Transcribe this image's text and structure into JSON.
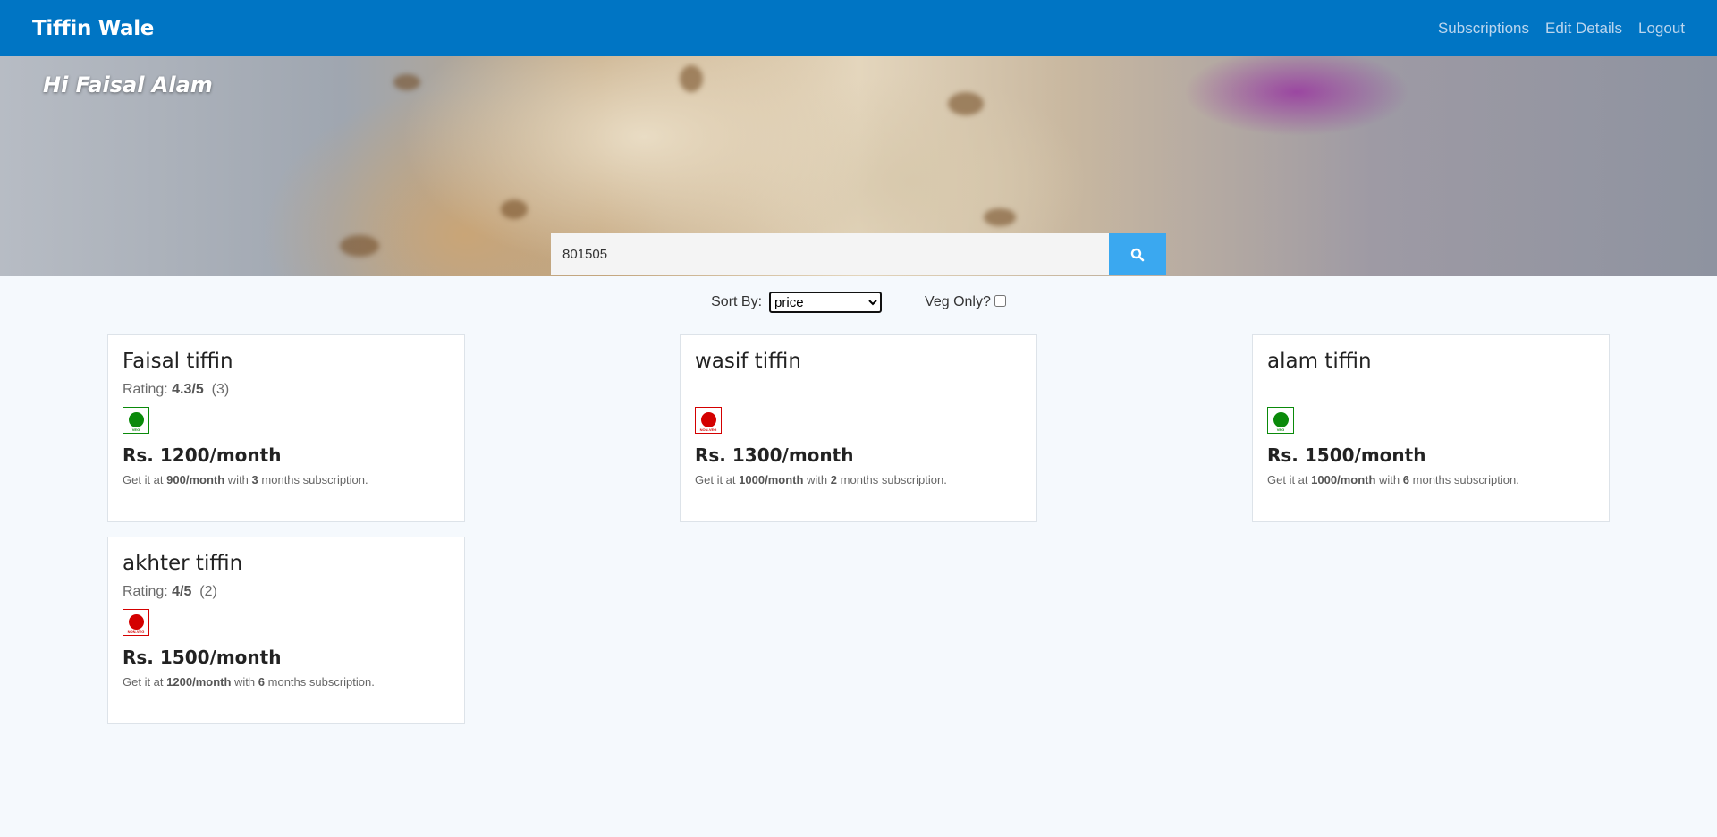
{
  "navbar": {
    "brand": "Tiffin Wale",
    "links": [
      "Subscriptions",
      "Edit Details",
      "Logout"
    ]
  },
  "hero": {
    "greeting": "Hi Faisal Alam"
  },
  "search": {
    "value": "801505",
    "button_icon": "search-icon"
  },
  "filters": {
    "sort_label": "Sort By:",
    "sort_selected": "price",
    "veg_label": "Veg Only?",
    "veg_checked": false
  },
  "colors": {
    "navbar": "#0075c4",
    "search_button": "#3aa8f0",
    "veg": "#0a8a0a",
    "non_veg": "#d40000"
  },
  "tiffins": [
    {
      "name": "Faisal tiffin",
      "rating_prefix": "Rating:",
      "rating": "4.3/5",
      "rating_count": "(3)",
      "type": "veg",
      "type_label": "VEG",
      "price": "Rs. 1200/month",
      "offer_pre": "Get it at",
      "offer_price": "900/month",
      "offer_mid": "with",
      "offer_months": "3",
      "offer_post": "months subscription."
    },
    {
      "name": "wasif tiffin",
      "rating_prefix": "",
      "rating": "",
      "rating_count": "",
      "type": "non-veg",
      "type_label": "NON-VEG",
      "price": "Rs. 1300/month",
      "offer_pre": "Get it at",
      "offer_price": "1000/month",
      "offer_mid": "with",
      "offer_months": "2",
      "offer_post": "months subscription."
    },
    {
      "name": "alam tiffin",
      "rating_prefix": "",
      "rating": "",
      "rating_count": "",
      "type": "veg",
      "type_label": "VEG",
      "price": "Rs. 1500/month",
      "offer_pre": "Get it at",
      "offer_price": "1000/month",
      "offer_mid": "with",
      "offer_months": "6",
      "offer_post": "months subscription."
    },
    {
      "name": "akhter tiffin",
      "rating_prefix": "Rating:",
      "rating": "4/5",
      "rating_count": "(2)",
      "type": "non-veg",
      "type_label": "NON-VEG",
      "price": "Rs. 1500/month",
      "offer_pre": "Get it at",
      "offer_price": "1200/month",
      "offer_mid": "with",
      "offer_months": "6",
      "offer_post": "months subscription."
    }
  ]
}
